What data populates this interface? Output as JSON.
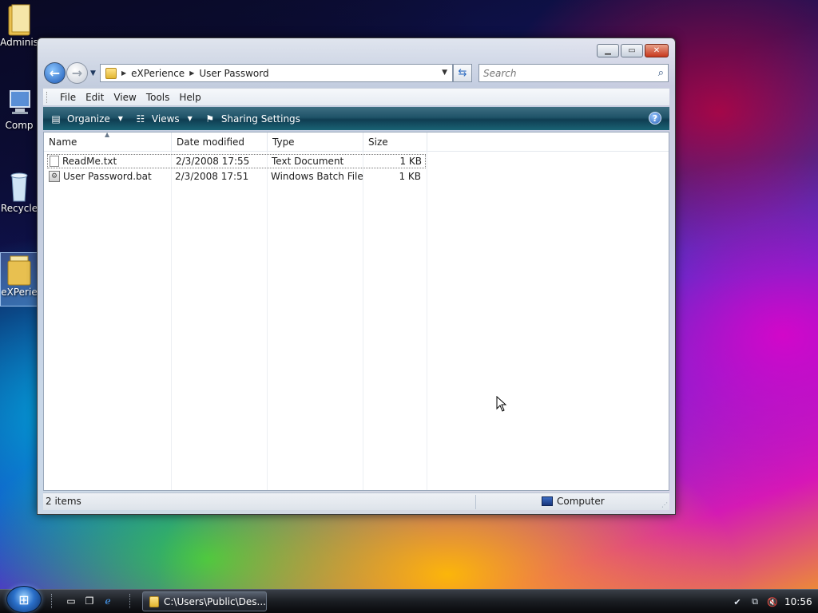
{
  "desktop": {
    "icons": [
      {
        "label": "Adminis",
        "icon": "user-folder-icon"
      },
      {
        "label": "Comp",
        "icon": "computer-icon"
      },
      {
        "label": "Recycle",
        "icon": "recycle-bin-icon"
      },
      {
        "label": "eXPerie",
        "icon": "folder-icon",
        "selected": true
      }
    ]
  },
  "window": {
    "breadcrumb": [
      "eXPerience",
      "User Password"
    ],
    "search_placeholder": "Search",
    "menu": [
      "File",
      "Edit",
      "View",
      "Tools",
      "Help"
    ],
    "commands": {
      "organize": "Organize",
      "views": "Views",
      "sharing": "Sharing Settings"
    },
    "columns": [
      "Name",
      "Date modified",
      "Type",
      "Size"
    ],
    "files": [
      {
        "name": "ReadMe.txt",
        "date": "2/3/2008 17:55",
        "type": "Text Document",
        "size": "1 KB",
        "icon": "text-file-icon"
      },
      {
        "name": "User Password.bat",
        "date": "2/3/2008 17:51",
        "type": "Windows Batch File",
        "size": "1 KB",
        "icon": "batch-file-icon"
      }
    ],
    "status": {
      "count": "2 items",
      "zone": "Computer"
    }
  },
  "taskbar": {
    "task_label": "C:\\Users\\Public\\Des...",
    "clock": "10:56"
  },
  "colors": {
    "command_bar": "#1f5368",
    "taskbar": "#1a1d22",
    "close_button": "#c7381c"
  }
}
